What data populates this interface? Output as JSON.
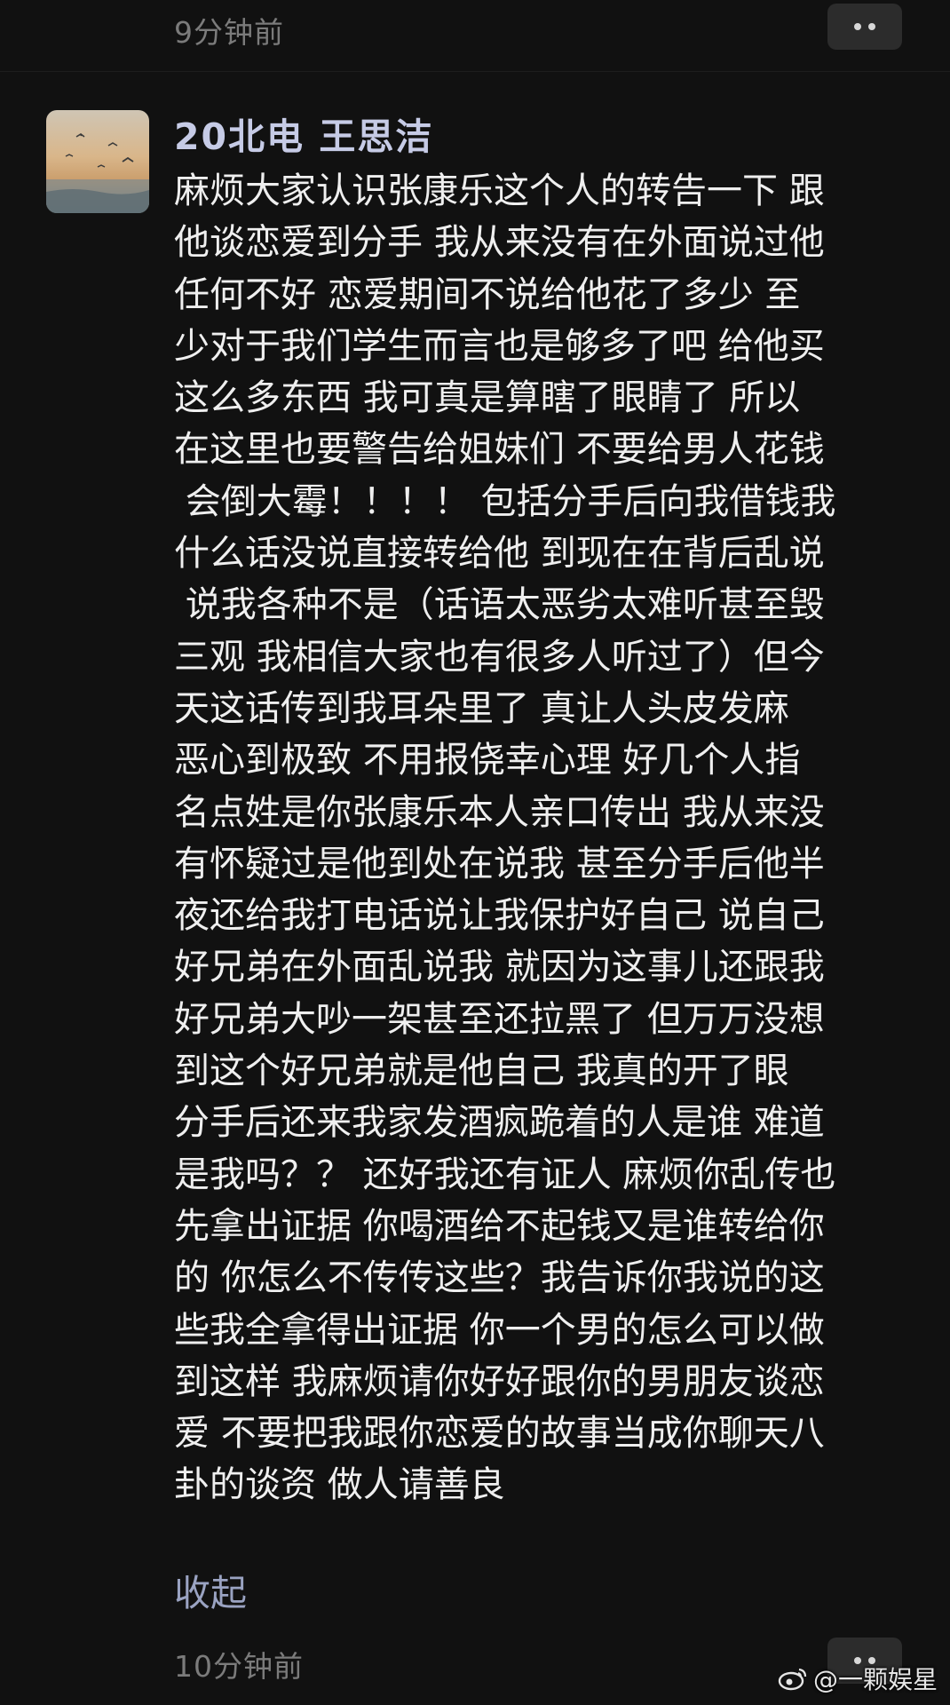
{
  "top": {
    "timestamp": "9分钟前",
    "more_icon": "ellipsis-icon"
  },
  "comment": {
    "avatar_icon": "sunset-seagulls-avatar",
    "username": "20北电 王思洁",
    "text_lines": [
      "麻烦大家认识张康乐这个人的转告一下 跟",
      "他谈恋爱到分手 我从来没有在外面说过他",
      "任何不好 恋爱期间不说给他花了多少 至",
      "少对于我们学生而言也是够多了吧 给他买",
      "这么多东西 我可真是算瞎了眼睛了 所以",
      "在这里也要警告给姐妹们 不要给男人花钱",
      " 会倒大霉！！！！ 包括分手后向我借钱我",
      "什么话没说直接转给他 到现在在背后乱说",
      " 说我各种不是（话语太恶劣太难听甚至毁",
      "三观 我相信大家也有很多人听过了）但今",
      "天这话传到我耳朵里了 真让人头皮发麻",
      "恶心到极致 不用报侥幸心理 好几个人指",
      "名点姓是你张康乐本人亲口传出 我从来没",
      "有怀疑过是他到处在说我 甚至分手后他半",
      "夜还给我打电话说让我保护好自己 说自己",
      "好兄弟在外面乱说我 就因为这事儿还跟我",
      "好兄弟大吵一架甚至还拉黑了 但万万没想",
      "到这个好兄弟就是他自己 我真的开了眼",
      "分手后还来我家发酒疯跪着的人是谁 难道",
      "是我吗？？ 还好我还有证人 麻烦你乱传也",
      "先拿出证据 你喝酒给不起钱又是谁转给你",
      "的 你怎么不传传这些？我告诉你我说的这",
      "些我全拿得出证据 你一个男的怎么可以做",
      "到这样 我麻烦请你好好跟你的男朋友谈恋",
      "爱 不要把我跟你恋爱的故事当成你聊天八",
      "卦的谈资 做人请善良"
    ],
    "collapse_label": "收起"
  },
  "bottom": {
    "timestamp": "10分钟前",
    "more_icon": "ellipsis-icon"
  },
  "watermark": {
    "logo_icon": "weibo-logo-icon",
    "text": "@一颗娱星"
  },
  "colors": {
    "background": "#111111",
    "username": "#c6cbe6",
    "link": "#9aa3c2",
    "timestamp": "#7b7b7b"
  }
}
